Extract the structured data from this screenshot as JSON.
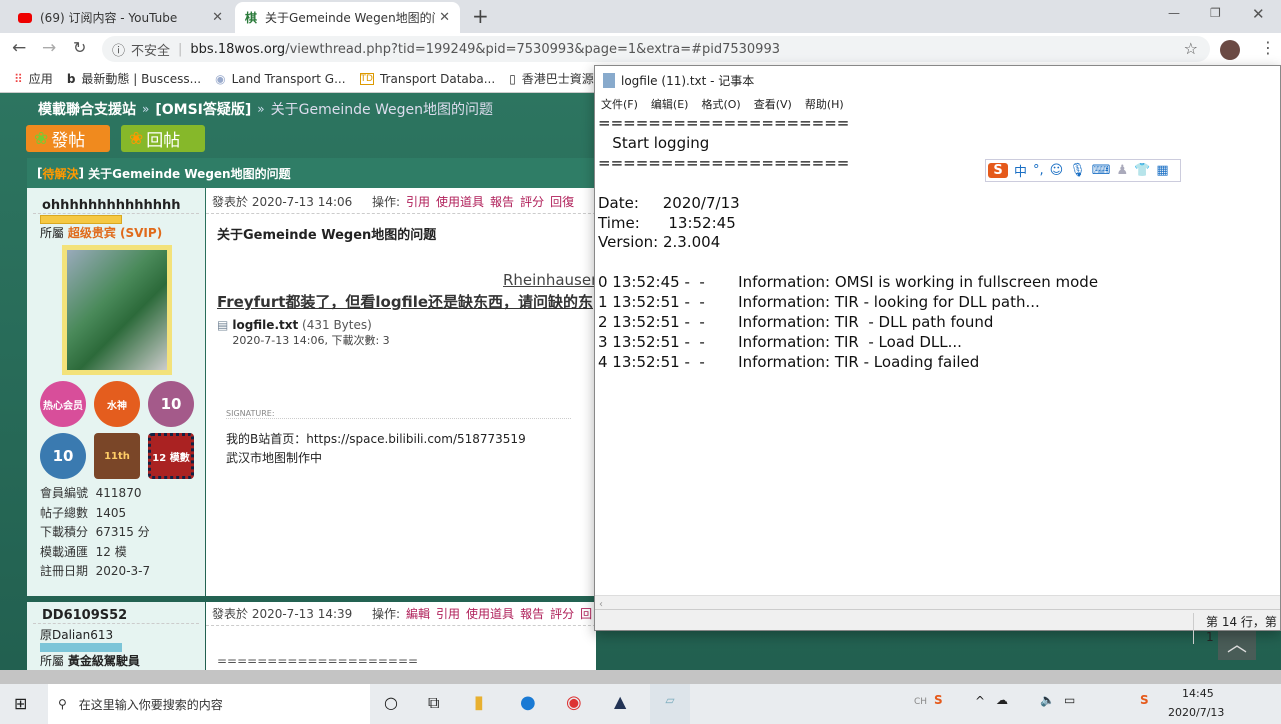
{
  "browser": {
    "tabs": [
      {
        "label": "(69) 订阅内容 - YouTube",
        "icon": "youtube-icon"
      },
      {
        "label": "关于Gemeinde Wegen地图的问",
        "icon": "site-icon"
      }
    ],
    "new_tab": "+",
    "security": "不安全",
    "url_host": "bbs.18wos.org",
    "url_path": "/viewthread.php?tid=199249&pid=7530993&page=1&extra=#pid7530993",
    "bookmarks": [
      "应用",
      "最新動態 | Buscess...",
      "Land Transport G...",
      "Transport Databa...",
      "香港巴士資源"
    ]
  },
  "forum": {
    "breadcrumb": [
      "模載聯合支援站",
      "»",
      "[OMSI答疑版]",
      "»",
      "关于Gemeinde Wegen地图的问题"
    ],
    "post_button": "發帖",
    "reply_button": "回帖",
    "thread_status": "待解決",
    "thread_title": "关于Gemeinde Wegen地图的问题",
    "posts": [
      {
        "author": "ohhhhhhhhhhhhhh",
        "group_label": "所屬",
        "group": "超级贵宾 (SVIP)",
        "posted": "發表於 2020-7-13 14:06",
        "ops_label": "操作:",
        "ops": [
          "引用",
          "使用道具",
          "報告",
          "評分",
          "回復"
        ],
        "title": "关于Gemeinde Wegen地图的问题",
        "body_line1": "Rheinhausen",
        "body_line2": "Freyfurt都装了，但看logfile还是缺东西，请问缺的东",
        "attachment": {
          "name": "logfile.txt",
          "size": "(431 Bytes)",
          "info": "2020-7-13 14:06, 下載次數: 3"
        },
        "signature_label": "SIGNATURE:",
        "signature": [
          "我的B站首页：https://space.bilibili.com/518773519",
          "武汉市地图制作中"
        ],
        "badges": [
          "热心会员",
          "水神",
          "10",
          "10",
          "11th",
          "12 模數"
        ],
        "stats": [
          [
            "會員編號",
            "411870"
          ],
          [
            "帖子總數",
            "1405"
          ],
          [
            "下載積分",
            "67315 分"
          ],
          [
            "模載通匯",
            "12 模"
          ],
          [
            "註冊日期",
            "2020-3-7"
          ]
        ]
      },
      {
        "author": "DD6109S52",
        "subtitle": "原Dalian613",
        "group_label": "所屬",
        "group": "黃金級駕駛員",
        "posted": "發表於 2020-7-13 14:39",
        "ops_label": "操作:",
        "ops": [
          "編輯",
          "引用",
          "使用道具",
          "報告",
          "評分",
          "回"
        ],
        "body_line1": "===================="
      }
    ]
  },
  "notepad": {
    "title": "logfile (11).txt - 记事本",
    "menu": [
      "文件(F)",
      "编辑(E)",
      "格式(O)",
      "查看(V)",
      "帮助(H)"
    ],
    "content": "====================\n   Start logging\n====================\n\nDate:     2020/7/13\nTime:      13:52:45\nVersion: 2.3.004\n\n0 13:52:45 -  -       Information: OMSI is working in fullscreen mode\n1 13:52:51 -  -       Information: TIR - looking for DLL path...\n2 13:52:51 -  -       Information: TIR  - DLL path found\n3 13:52:51 -  -       Information: TIR  - Load DLL...\n4 13:52:51 -  -       Information: TIR - Loading failed\n",
    "status": "第 14 行，第 1"
  },
  "ime": {
    "mode": "中",
    "punct": "°,"
  },
  "taskbar": {
    "search_placeholder": "在这里输入你要搜索的内容",
    "time": "14:45",
    "date": "2020/7/13",
    "tray_lang": "CH"
  }
}
